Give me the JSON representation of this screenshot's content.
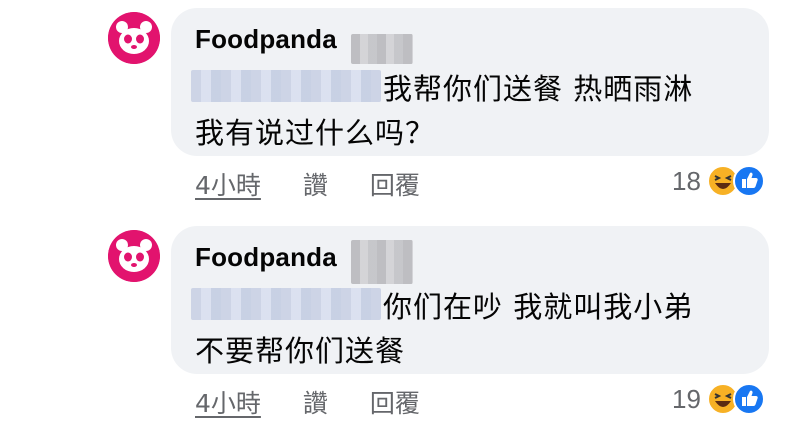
{
  "comments": [
    {
      "author": "Foodpanda",
      "line1": "我帮你们送餐 热晒雨淋",
      "line2": "我有说过什么吗？",
      "time": "4小時",
      "action_like": "讚",
      "action_reply": "回覆",
      "reaction_count": "18",
      "reactions": [
        "haha-icon",
        "like-icon"
      ]
    },
    {
      "author": "Foodpanda",
      "line1": "你们在吵 我就叫我小弟",
      "line2": "不要帮你们送餐",
      "time": "4小時",
      "action_like": "讚",
      "action_reply": "回覆",
      "reaction_count": "19",
      "reactions": [
        "haha-icon",
        "like-icon"
      ]
    }
  ],
  "colors": {
    "bubble": "#f0f2f5",
    "meta_text": "#65676b",
    "brand_pink": "#e2136e",
    "like_blue": "#1877f2",
    "haha_yellow": "#f7b125"
  }
}
